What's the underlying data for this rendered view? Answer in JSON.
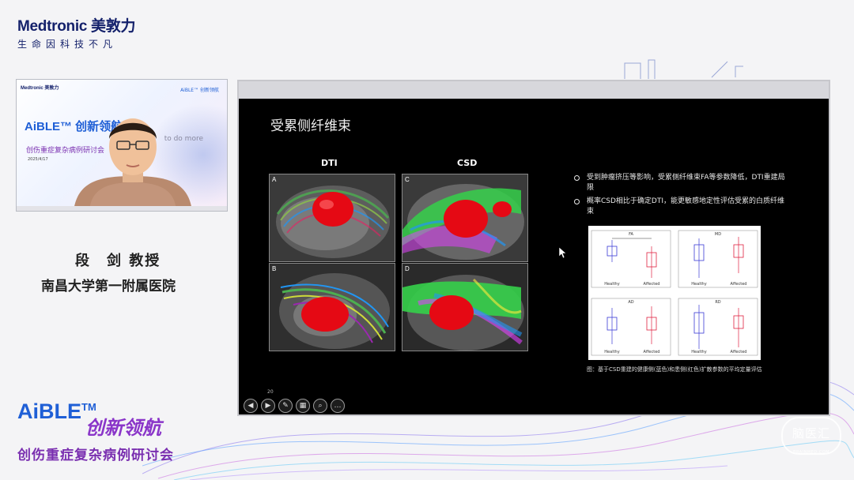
{
  "brand": {
    "name": "Medtronic 美敦力",
    "tagline": "生命因科技不凡"
  },
  "camera": {
    "mini_brand": "Medtronic 美敦力",
    "mini_aible": "AiBLE™ 创新领航",
    "mini_conference": "创伤重症复杂病例研讨会",
    "mini_date": "2025/4/17",
    "do_more": "to do more"
  },
  "speaker": {
    "name": "段　剑 教授",
    "affiliation": "南昌大学第一附属医院"
  },
  "event": {
    "aible": "AiBLE",
    "tm": "TM",
    "slogan": "创新领航",
    "conference": "创伤重症复杂病例研讨会"
  },
  "slide": {
    "title": "受累侧纤维束",
    "col_dti": "DTI",
    "col_csd": "CSD",
    "panels": {
      "a": "A",
      "b": "B",
      "c": "C",
      "d": "D"
    },
    "bullets": [
      "受到肿瘤挤压等影响，受累侧纤维束FA等参数降低，DTI重建局限",
      "概率CSD相比于确定DTI，能更敏感地定性评估受累的白质纤维束"
    ],
    "figure": {
      "plots": [
        "FA",
        "MD",
        "AD",
        "RD"
      ],
      "groups": [
        "Healthy",
        "Affected"
      ],
      "colors": {
        "healthy": "#3b3bd6",
        "affected": "#e02040"
      }
    },
    "caption": "图：基于CSD重建的健康侧(蓝色)和患侧(红色)扩散参数的平均定量评估",
    "page_number": "20"
  },
  "controls": [
    {
      "name": "prev",
      "icon": "◀"
    },
    {
      "name": "next",
      "icon": "▶"
    },
    {
      "name": "pen",
      "icon": "✎"
    },
    {
      "name": "slides",
      "icon": "▦"
    },
    {
      "name": "zoom",
      "icon": "⌕"
    },
    {
      "name": "more",
      "icon": "…"
    }
  ],
  "watermark": {
    "text": "脑医汇",
    "sub": "BRAINMED.COM"
  }
}
